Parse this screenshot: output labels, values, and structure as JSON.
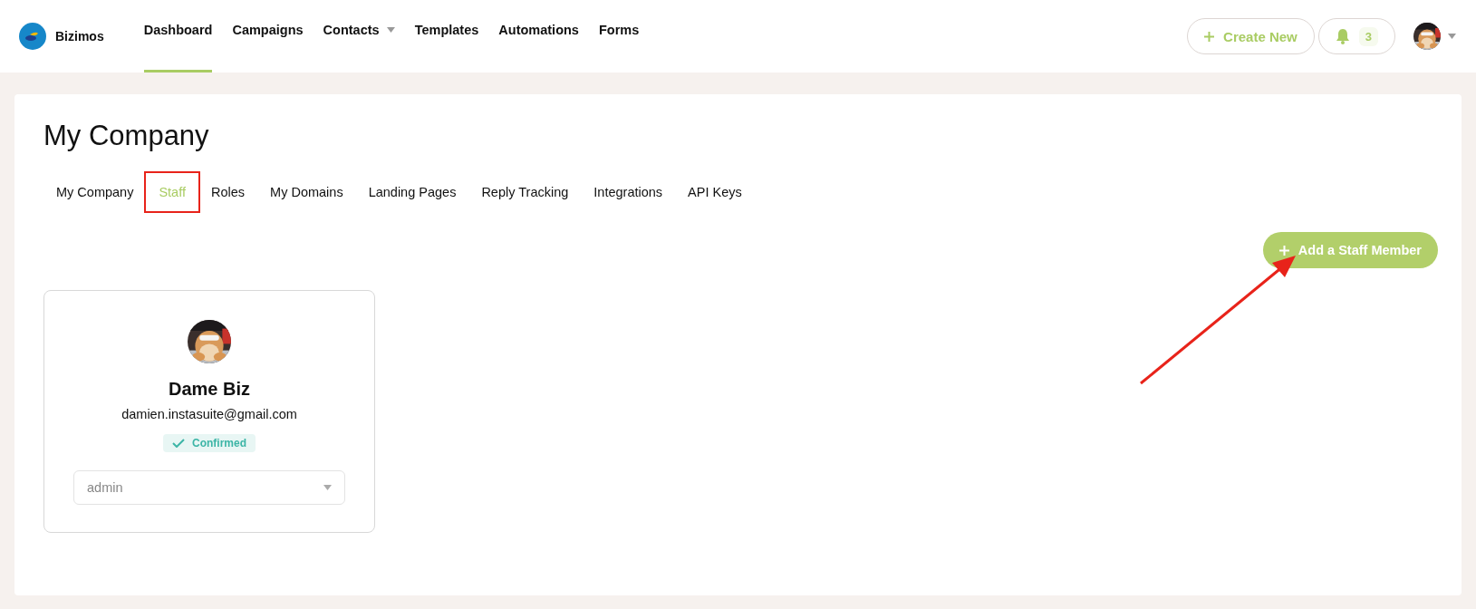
{
  "brand": {
    "name": "Bizimos"
  },
  "nav": [
    {
      "label": "Dashboard",
      "selected": true,
      "dropdown": false
    },
    {
      "label": "Campaigns",
      "selected": false,
      "dropdown": false
    },
    {
      "label": "Contacts",
      "selected": false,
      "dropdown": true
    },
    {
      "label": "Templates",
      "selected": false,
      "dropdown": false
    },
    {
      "label": "Automations",
      "selected": false,
      "dropdown": false
    },
    {
      "label": "Forms",
      "selected": false,
      "dropdown": false
    }
  ],
  "header_actions": {
    "create_label": "Create New",
    "notification_count": "3"
  },
  "page": {
    "title": "My Company"
  },
  "tabs": [
    {
      "label": "My Company",
      "selected": false,
      "boxed": false
    },
    {
      "label": "Staff",
      "selected": true,
      "boxed": true
    },
    {
      "label": "Roles",
      "selected": false,
      "boxed": false
    },
    {
      "label": "My Domains",
      "selected": false,
      "boxed": false
    },
    {
      "label": "Landing Pages",
      "selected": false,
      "boxed": false
    },
    {
      "label": "Reply Tracking",
      "selected": false,
      "boxed": false
    },
    {
      "label": "Integrations",
      "selected": false,
      "boxed": false
    },
    {
      "label": "API Keys",
      "selected": false,
      "boxed": false
    }
  ],
  "add_button": {
    "label": "Add a Staff Member"
  },
  "staff": [
    {
      "name": "Dame Biz",
      "email": "damien.instasuite@gmail.com",
      "status": "Confirmed",
      "confirmed": true,
      "role": "admin"
    }
  ],
  "annotations": [
    {
      "kind": "arrow"
    }
  ]
}
